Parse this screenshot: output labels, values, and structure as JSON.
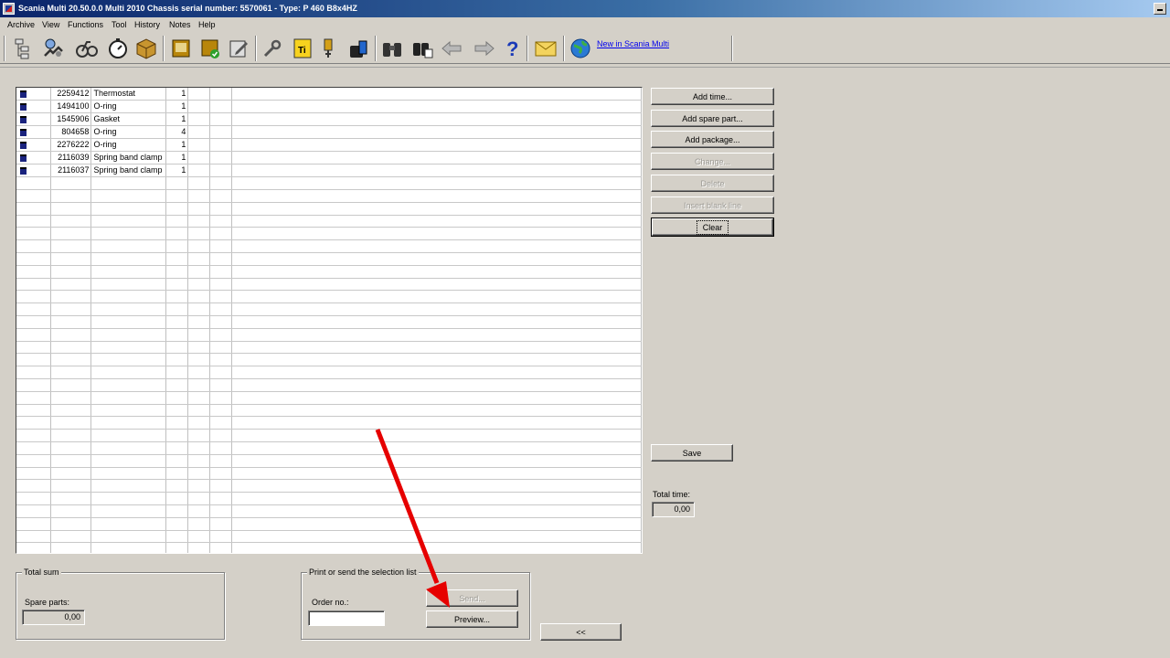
{
  "window": {
    "title": "Scania Multi   20.50.0.0   Multi 2010     Chassis serial number: 5570061 -  Type: P 460 B8x4HZ"
  },
  "menu": [
    "Archive",
    "View",
    "Functions",
    "Tool",
    "History",
    "Notes",
    "Help"
  ],
  "toolbar": {
    "icons": [
      "tree-structure-icon",
      "search-parts-icon",
      "bicycle-parts-icon",
      "stopwatch-icon",
      "package-box-icon",
      "book-icon",
      "book-check-icon",
      "notepad-pen-icon",
      "wrench-icon",
      "ti-document-icon",
      "flashlight-icon",
      "tools-bag-icon",
      "binoculars-icon",
      "search-history-icon",
      "back-arrow-icon",
      "forward-arrow-icon",
      "help-icon",
      "mail-icon",
      "globe-icon"
    ],
    "news_link": "New in Scania Multi"
  },
  "parts": [
    {
      "number": "2259412",
      "name": "Thermostat",
      "qty": "1"
    },
    {
      "number": "1494100",
      "name": "O-ring",
      "qty": "1"
    },
    {
      "number": "1545906",
      "name": "Gasket",
      "qty": "1"
    },
    {
      "number": "804658",
      "name": "O-ring",
      "qty": "4"
    },
    {
      "number": "2276222",
      "name": "O-ring",
      "qty": "1"
    },
    {
      "number": "2116039",
      "name": "Spring band clamp",
      "qty": "1"
    },
    {
      "number": "2116037",
      "name": "Spring band clamp",
      "qty": "1"
    }
  ],
  "side_buttons": {
    "add_time": "Add time...",
    "add_spare_part": "Add spare part...",
    "add_package": "Add package...",
    "change": "Change...",
    "delete": "Delete",
    "insert_blank_line": "Insert blank line",
    "clear": "Clear",
    "save": "Save"
  },
  "total_time": {
    "label": "Total time:",
    "value": "0,00"
  },
  "total_sum": {
    "title": "Total sum",
    "spare_parts_label": "Spare parts:",
    "spare_parts_value": "0,00"
  },
  "print_send": {
    "title": "Print or send the selection list",
    "order_label": "Order no.:",
    "order_value": "",
    "send": "Send...",
    "preview": "Preview..."
  },
  "collapse_button": "<<",
  "colors": {
    "title_start": "#0a246a",
    "title_end": "#a6caf0",
    "window_bg": "#d4d0c8",
    "annotation_arrow": "#e60000"
  }
}
